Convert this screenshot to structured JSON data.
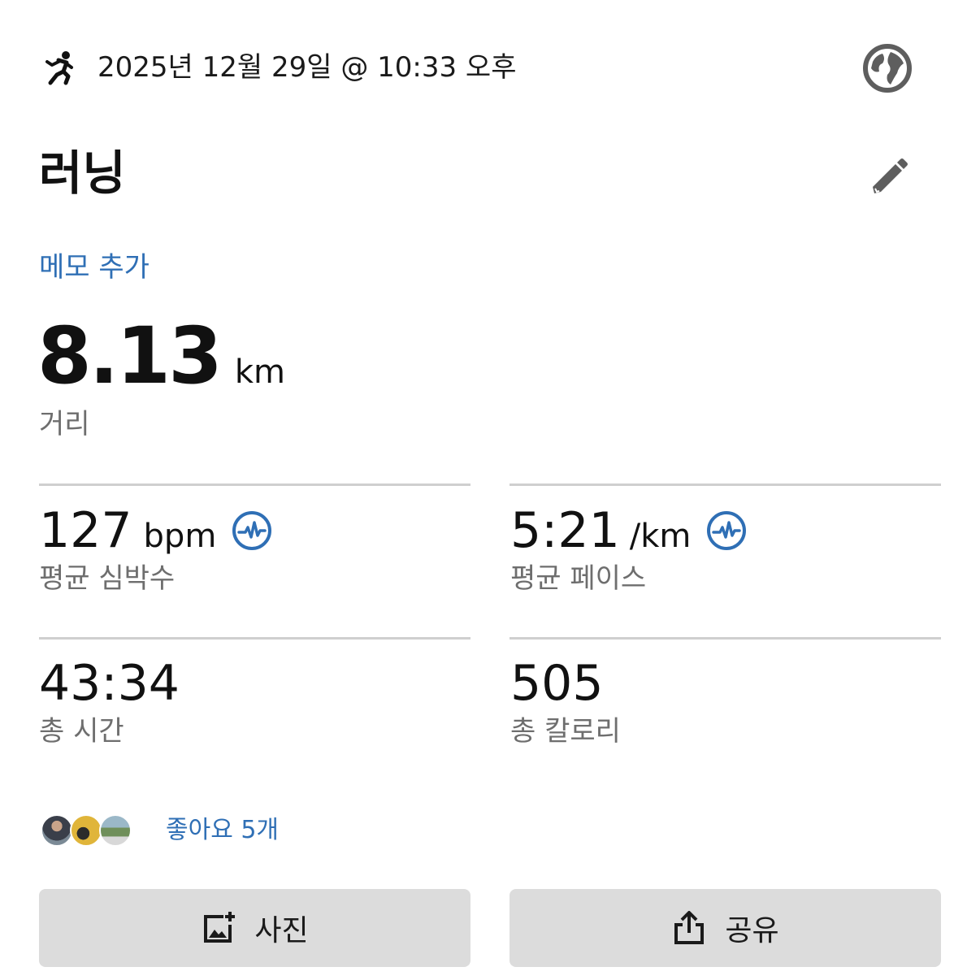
{
  "header": {
    "activity_icon": "running-person-icon",
    "date_time": "2025년 12월 29일 @ 10:33 오후",
    "privacy_icon": "globe-icon"
  },
  "activity": {
    "title": "러닝",
    "edit_icon": "pencil-icon",
    "memo_link": "메모 추가"
  },
  "distance": {
    "value": "8.13",
    "unit": "km",
    "label": "거리"
  },
  "stats": [
    {
      "value": "127",
      "unit": "bpm",
      "label": "평균 심박수",
      "icon": "pulse-icon"
    },
    {
      "value": "5:21",
      "unit": "/km",
      "label": "평균 페이스",
      "icon": "pulse-icon"
    },
    {
      "value": "43:34",
      "unit": "",
      "label": "총 시간"
    },
    {
      "value": "505",
      "unit": "",
      "label": "총 칼로리"
    }
  ],
  "likes": {
    "text": "좋아요 5개",
    "avatars": [
      "avatar-1",
      "avatar-2",
      "avatar-3"
    ]
  },
  "actions": {
    "photo": {
      "label": "사진",
      "icon": "add-photo-icon"
    },
    "share": {
      "label": "공유",
      "icon": "share-icon"
    }
  },
  "colors": {
    "link": "#2f6fb5",
    "secondary_text": "#6e6e6e",
    "divider": "#cfcfcf",
    "button_bg": "#dcdcdc"
  }
}
